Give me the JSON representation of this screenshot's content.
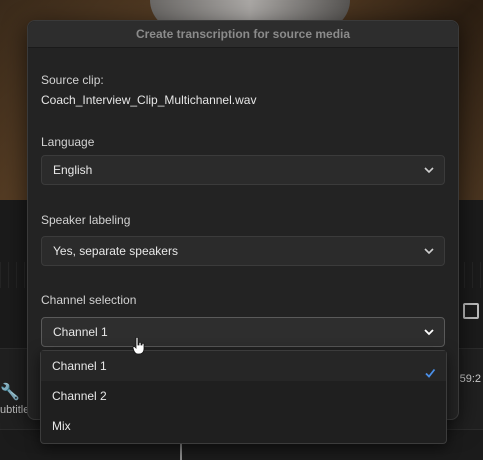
{
  "dialog": {
    "title": "Create transcription for source media"
  },
  "source_clip": {
    "label": "Source clip:",
    "value": "Coach_Interview_Clip_Multichannel.wav"
  },
  "language": {
    "label": "Language",
    "selected": "English"
  },
  "speaker_labeling": {
    "label": "Speaker labeling",
    "selected": "Yes, separate speakers"
  },
  "channel_selection": {
    "label": "Channel selection",
    "selected": "Channel 1",
    "options": [
      "Channel 1",
      "Channel 2",
      "Mix"
    ]
  },
  "background": {
    "track_label": "ubtitle",
    "timecode": ":59:2"
  },
  "icons": {
    "chevron": "chevron-down-icon",
    "check": "checkmark-icon",
    "cursor": "hand-pointer-icon",
    "wrench": "wrench-icon"
  },
  "colors": {
    "dialog_bg": "#232323",
    "accent_check": "#4a8fe8",
    "text": "#e8e8e8"
  }
}
